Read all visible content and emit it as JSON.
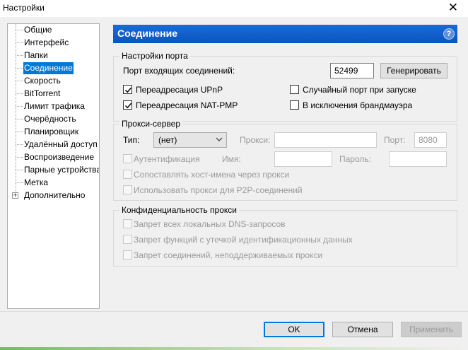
{
  "window": {
    "title": "Настройки",
    "close_glyph": "✕"
  },
  "tree": {
    "items": [
      {
        "label": "Общие"
      },
      {
        "label": "Интерфейс"
      },
      {
        "label": "Папки"
      },
      {
        "label": "Соединение",
        "selected": true
      },
      {
        "label": "Скорость"
      },
      {
        "label": "BitTorrent"
      },
      {
        "label": "Лимит трафика"
      },
      {
        "label": "Очерёдность"
      },
      {
        "label": "Планировщик"
      },
      {
        "label": "Удалённый доступ"
      },
      {
        "label": "Воспроизведение"
      },
      {
        "label": "Парные устройства"
      },
      {
        "label": "Метка"
      },
      {
        "label": "Дополнительно",
        "expandable": true
      }
    ]
  },
  "header": {
    "title": "Соединение",
    "help_glyph": "?"
  },
  "port_settings": {
    "group_title": "Настройки порта",
    "incoming_port_label": "Порт входящих соединений:",
    "incoming_port_value": "52499",
    "generate_button": "Генерировать",
    "upnp_label": "Переадресация UPnP",
    "upnp_checked": true,
    "natpmp_label": "Переадресация NAT-PMP",
    "natpmp_checked": true,
    "random_port_label": "Случайный порт при запуске",
    "random_port_checked": false,
    "firewall_label": "В исключения брандмауэра",
    "firewall_checked": false
  },
  "proxy": {
    "group_title": "Прокси-сервер",
    "type_label": "Тип:",
    "type_value": "(нет)",
    "proxy_label": "Прокси:",
    "proxy_value": "",
    "port_label": "Порт:",
    "port_value": "8080",
    "auth_label": "Аутентификация",
    "username_label": "Имя:",
    "username_value": "",
    "password_label": "Пароль:",
    "password_value": "",
    "resolve_label": "Сопоставлять хост-имена через прокси",
    "p2p_label": "Использовать прокси для P2P-соединений"
  },
  "privacy": {
    "group_title": "Конфиденциальность прокси",
    "dns_label": "Запрет всех локальных DNS-запросов",
    "leak_label": "Запрет функций с утечкой идентификационных данных",
    "unsupported_label": "Запрет соединений, неподдерживаемых прокси"
  },
  "footer": {
    "ok": "OK",
    "cancel": "Отмена",
    "apply": "Применить"
  },
  "colors": {
    "accent": "#0078d7",
    "header_bg": "#0f5ccb"
  }
}
